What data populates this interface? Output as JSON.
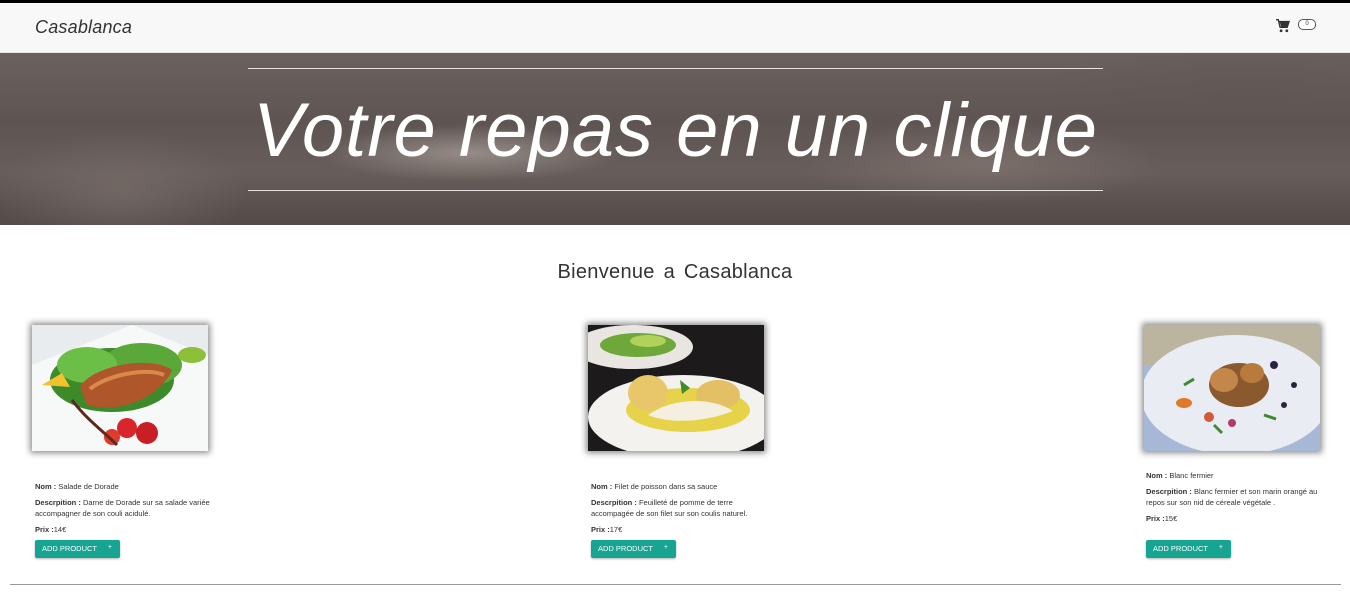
{
  "navbar": {
    "brand": "Casablanca",
    "cart_icon": "shopping-cart-icon",
    "cart_count": "0"
  },
  "hero": {
    "title": "Votre repas en un clique"
  },
  "welcome": "Bienvenue  a  Casablanca",
  "labels": {
    "nom": "Nom :",
    "description": "Descrpition :",
    "prix": "Prix :"
  },
  "colors": {
    "button": "#17a592",
    "navbar": "#f8f8f8"
  },
  "products": [
    {
      "name": "Salade de Dorade",
      "description": "Darne de Dorade sur sa salade variée accompagner de son couli acidulé.",
      "price": "14€",
      "button": "ADD PRODUCT",
      "button_icon": "+"
    },
    {
      "name": "Filet de poisson dans sa sauce",
      "description": "Feuilleté de pomme de terre accompagée de son filet sur son coulis naturel.",
      "price": "17€",
      "button": "ADD PRODUCT",
      "button_icon": "+"
    },
    {
      "name": "Blanc fermier",
      "description": "Blanc fermier et son marin orangé au repos sur son nid de céreale végétale .",
      "price": "15€",
      "button": "ADD PRODUCT",
      "button_icon": "+"
    }
  ]
}
